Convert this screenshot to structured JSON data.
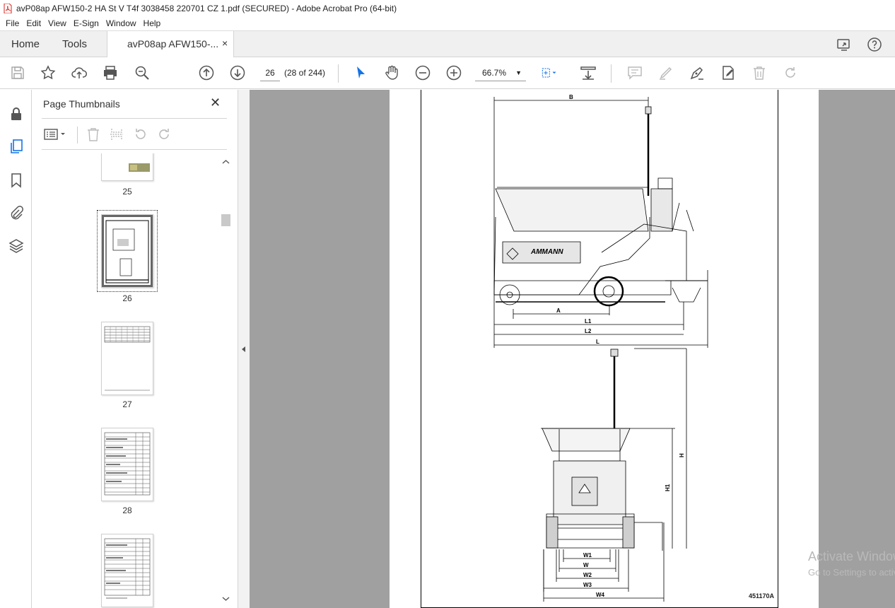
{
  "window": {
    "title": "avP08ap AFW150-2 HA St V T4f 3038458 220701 CZ 1.pdf (SECURED) - Adobe Acrobat Pro (64-bit)"
  },
  "menu": [
    "File",
    "Edit",
    "View",
    "E-Sign",
    "Window",
    "Help"
  ],
  "tabs": {
    "home": "Home",
    "tools": "Tools",
    "document": "avP08ap AFW150-...",
    "close": "×"
  },
  "toolbar": {
    "page_number": "26",
    "page_count": "(28 of 244)",
    "zoom": "66.7%"
  },
  "panel": {
    "title": "Page Thumbnails",
    "close": "✕",
    "thumbnails": [
      {
        "label": "25"
      },
      {
        "label": "26"
      },
      {
        "label": "27"
      },
      {
        "label": "28"
      },
      {
        "label": ""
      }
    ]
  },
  "document": {
    "dimension_labels": {
      "B": "B",
      "A": "A",
      "L1": "L1",
      "L2": "L2",
      "L": "L",
      "H": "H",
      "H1": "H1",
      "W1": "W1",
      "W": "W",
      "W2": "W2",
      "W3": "W3",
      "W4": "W4"
    },
    "brand": "AMMANN",
    "figure_code": "451170A"
  },
  "watermark": {
    "line1": "Activate Windows",
    "line2": "Go to Settings to activate Windows."
  },
  "colors": {
    "accent_blue": "#1473e6",
    "pdf_red": "#d7241e",
    "doc_background": "#a0a0a0"
  }
}
